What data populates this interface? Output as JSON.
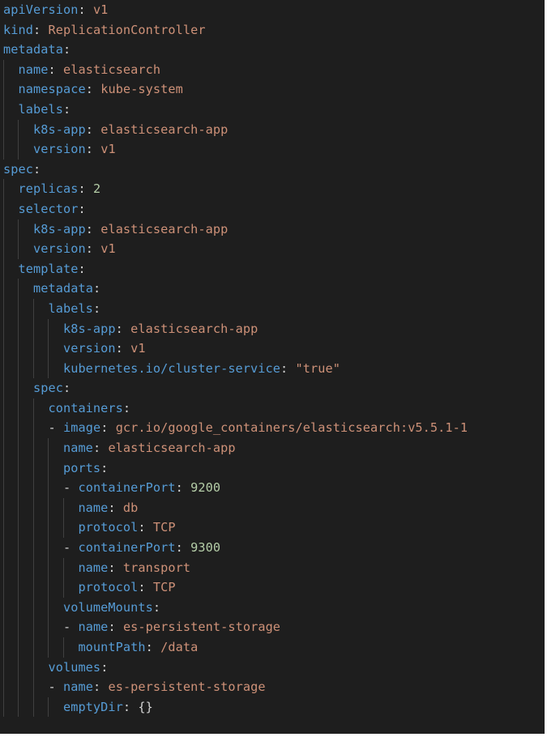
{
  "theme": {
    "background": "#1e1e1e",
    "key_color": "#569cd6",
    "string_color": "#ce9178",
    "number_color": "#b5cea8",
    "punctuation_color": "#d4d4d4",
    "indent_guide_color": "#404040"
  },
  "lines": [
    {
      "indent": 0,
      "dash": false,
      "key": "apiVersion",
      "value": "v1",
      "value_type": "string"
    },
    {
      "indent": 0,
      "dash": false,
      "key": "kind",
      "value": "ReplicationController",
      "value_type": "string"
    },
    {
      "indent": 0,
      "dash": false,
      "key": "metadata",
      "value": "",
      "value_type": "none"
    },
    {
      "indent": 1,
      "dash": false,
      "key": "name",
      "value": "elasticsearch",
      "value_type": "string"
    },
    {
      "indent": 1,
      "dash": false,
      "key": "namespace",
      "value": "kube-system",
      "value_type": "string"
    },
    {
      "indent": 1,
      "dash": false,
      "key": "labels",
      "value": "",
      "value_type": "none"
    },
    {
      "indent": 2,
      "dash": false,
      "key": "k8s-app",
      "value": "elasticsearch-app",
      "value_type": "string"
    },
    {
      "indent": 2,
      "dash": false,
      "key": "version",
      "value": "v1",
      "value_type": "string"
    },
    {
      "indent": 0,
      "dash": false,
      "key": "spec",
      "value": "",
      "value_type": "none"
    },
    {
      "indent": 1,
      "dash": false,
      "key": "replicas",
      "value": "2",
      "value_type": "number"
    },
    {
      "indent": 1,
      "dash": false,
      "key": "selector",
      "value": "",
      "value_type": "none"
    },
    {
      "indent": 2,
      "dash": false,
      "key": "k8s-app",
      "value": "elasticsearch-app",
      "value_type": "string"
    },
    {
      "indent": 2,
      "dash": false,
      "key": "version",
      "value": "v1",
      "value_type": "string"
    },
    {
      "indent": 1,
      "dash": false,
      "key": "template",
      "value": "",
      "value_type": "none"
    },
    {
      "indent": 2,
      "dash": false,
      "key": "metadata",
      "value": "",
      "value_type": "none"
    },
    {
      "indent": 3,
      "dash": false,
      "key": "labels",
      "value": "",
      "value_type": "none"
    },
    {
      "indent": 4,
      "dash": false,
      "key": "k8s-app",
      "value": "elasticsearch-app",
      "value_type": "string"
    },
    {
      "indent": 4,
      "dash": false,
      "key": "version",
      "value": "v1",
      "value_type": "string"
    },
    {
      "indent": 4,
      "dash": false,
      "key": "kubernetes.io/cluster-service",
      "value": "\"true\"",
      "value_type": "string"
    },
    {
      "indent": 2,
      "dash": false,
      "key": "spec",
      "value": "",
      "value_type": "none"
    },
    {
      "indent": 3,
      "dash": false,
      "key": "containers",
      "value": "",
      "value_type": "none"
    },
    {
      "indent": 3,
      "dash": true,
      "key": "image",
      "value": "gcr.io/google_containers/elasticsearch:v5.5.1-1",
      "value_type": "string"
    },
    {
      "indent": 4,
      "dash": false,
      "key": "name",
      "value": "elasticsearch-app",
      "value_type": "string"
    },
    {
      "indent": 4,
      "dash": false,
      "key": "ports",
      "value": "",
      "value_type": "none"
    },
    {
      "indent": 4,
      "dash": true,
      "key": "containerPort",
      "value": "9200",
      "value_type": "number"
    },
    {
      "indent": 5,
      "dash": false,
      "key": "name",
      "value": "db",
      "value_type": "string"
    },
    {
      "indent": 5,
      "dash": false,
      "key": "protocol",
      "value": "TCP",
      "value_type": "string"
    },
    {
      "indent": 4,
      "dash": true,
      "key": "containerPort",
      "value": "9300",
      "value_type": "number"
    },
    {
      "indent": 5,
      "dash": false,
      "key": "name",
      "value": "transport",
      "value_type": "string"
    },
    {
      "indent": 5,
      "dash": false,
      "key": "protocol",
      "value": "TCP",
      "value_type": "string"
    },
    {
      "indent": 4,
      "dash": false,
      "key": "volumeMounts",
      "value": "",
      "value_type": "none"
    },
    {
      "indent": 4,
      "dash": true,
      "key": "name",
      "value": "es-persistent-storage",
      "value_type": "string"
    },
    {
      "indent": 5,
      "dash": false,
      "key": "mountPath",
      "value": "/data",
      "value_type": "string"
    },
    {
      "indent": 3,
      "dash": false,
      "key": "volumes",
      "value": "",
      "value_type": "none"
    },
    {
      "indent": 3,
      "dash": true,
      "key": "name",
      "value": "es-persistent-storage",
      "value_type": "string"
    },
    {
      "indent": 4,
      "dash": false,
      "key": "emptyDir",
      "value": "{}",
      "value_type": "punct"
    }
  ]
}
